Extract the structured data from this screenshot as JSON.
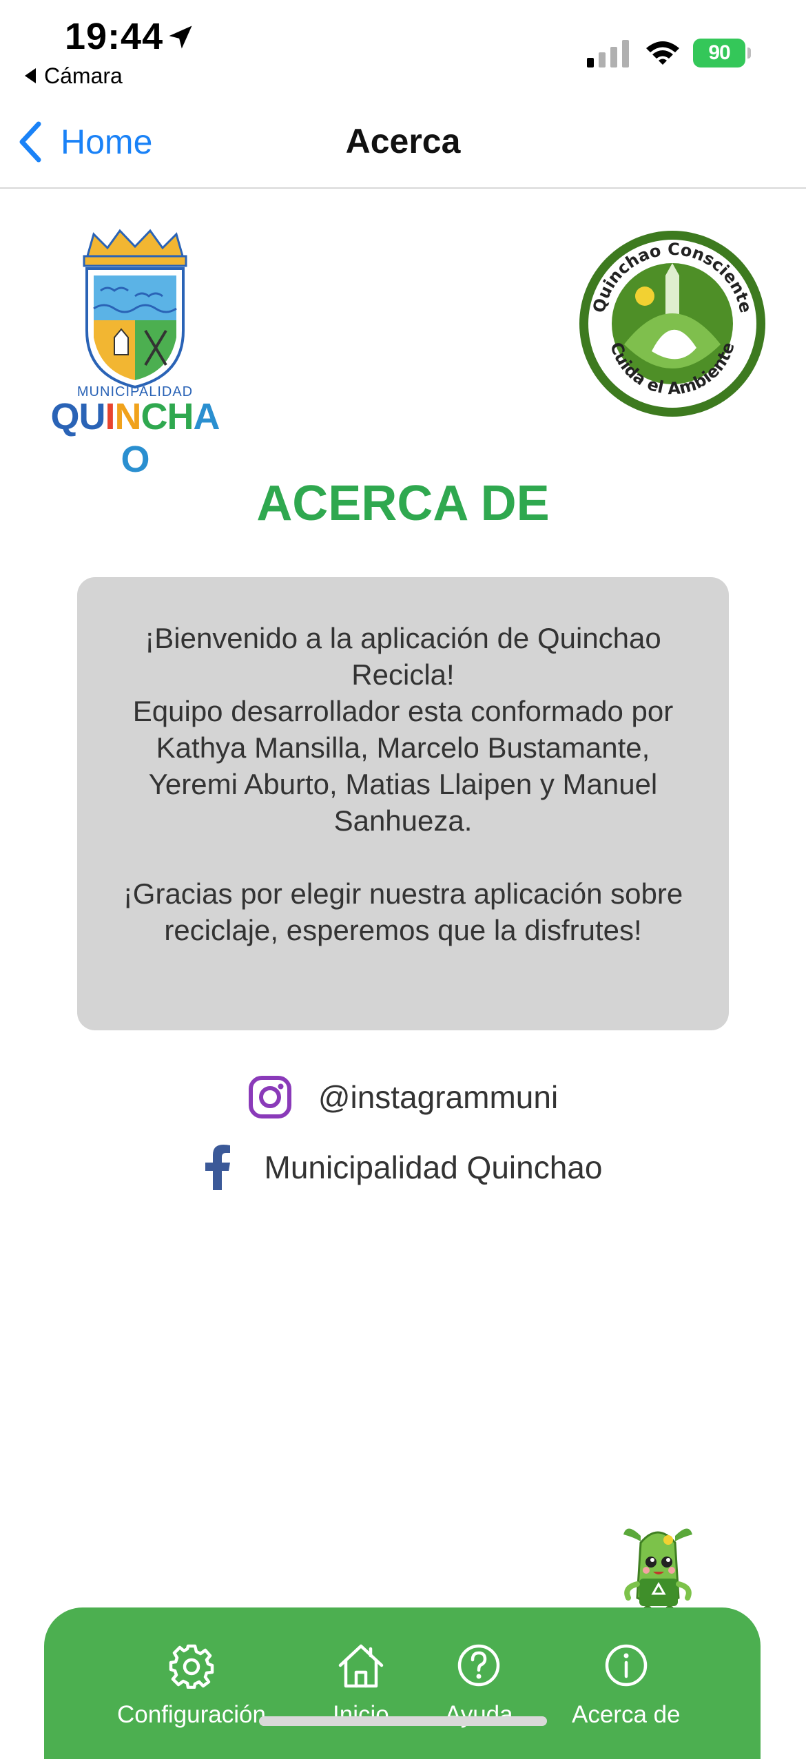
{
  "status_bar": {
    "time": "19:44",
    "back_app": "Cámara",
    "battery": "90"
  },
  "nav": {
    "back_label": "Home",
    "title": "Acerca"
  },
  "logos": {
    "muni_label": "MUNICIPALIDAD",
    "muni_name_letters": [
      "Q",
      "U",
      "I",
      "N",
      "C",
      "H",
      "A",
      "O"
    ],
    "muni_name_colors": [
      "#2a63b6",
      "#2a63b6",
      "#e8442f",
      "#f0a21c",
      "#2fa84f",
      "#2fa84f",
      "#2a8fd0",
      "#2a8fd0"
    ],
    "consciente_top": "Quinchao Consciente",
    "consciente_bottom": "Cuida el Ambiente"
  },
  "heading": "ACERCA DE",
  "card": {
    "line1": "¡Bienvenido a la aplicación de Quinchao Recicla!",
    "line2": "Equipo desarrollador esta conformado por Kathya Mansilla, Marcelo Bustamante, Yeremi Aburto, Matias Llaipen y Manuel Sanhueza.",
    "line3": "¡Gracias por elegir nuestra aplicación sobre reciclaje, esperemos que la disfrutes!"
  },
  "social": {
    "instagram": "@instagrammuni",
    "facebook": "Municipalidad Quinchao"
  },
  "tabs": [
    {
      "label": "Configuración",
      "icon": "gear-icon"
    },
    {
      "label": "Inicio",
      "icon": "home-icon"
    },
    {
      "label": "Ayuda",
      "icon": "help-icon"
    },
    {
      "label": "Acerca de",
      "icon": "info-icon"
    }
  ],
  "colors": {
    "accent_green": "#2fa84f",
    "tab_bar": "#4caf50",
    "link_blue": "#1a82f7",
    "card_bg": "#d4d4d4",
    "instagram": "#8a3ab9",
    "facebook": "#3b5998"
  }
}
